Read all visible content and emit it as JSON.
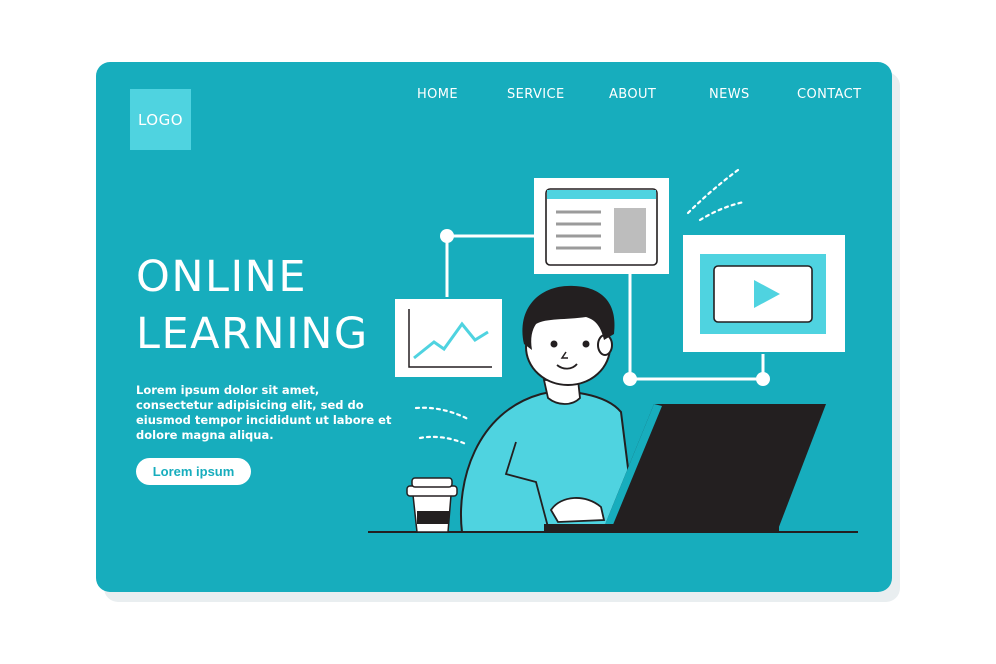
{
  "header": {
    "logo_text": "LOGO",
    "nav": [
      {
        "label": "HOME"
      },
      {
        "label": "SERVICE"
      },
      {
        "label": "ABOUT"
      },
      {
        "label": "NEWS"
      },
      {
        "label": "CONTACT"
      }
    ]
  },
  "hero": {
    "title_line1": "ONLINE",
    "title_line2": "LEARNING",
    "text": "Lorem ipsum dolor sit amet, consectetur adipisicing elit, sed do eiusmod tempor incididunt ut labore et dolore magna aliqua.",
    "button_label": "Lorem ipsum"
  },
  "colors": {
    "background": "#ffffff",
    "card": "#17adbd",
    "logo_box": "#4fd3e0",
    "ink": "#231f20",
    "accent_light": "#4fd3e0"
  },
  "illustration": {
    "icons": [
      "chart-window-icon",
      "article-window-icon",
      "video-window-icon",
      "coffee-cup-icon",
      "laptop-icon",
      "student-figure"
    ]
  }
}
